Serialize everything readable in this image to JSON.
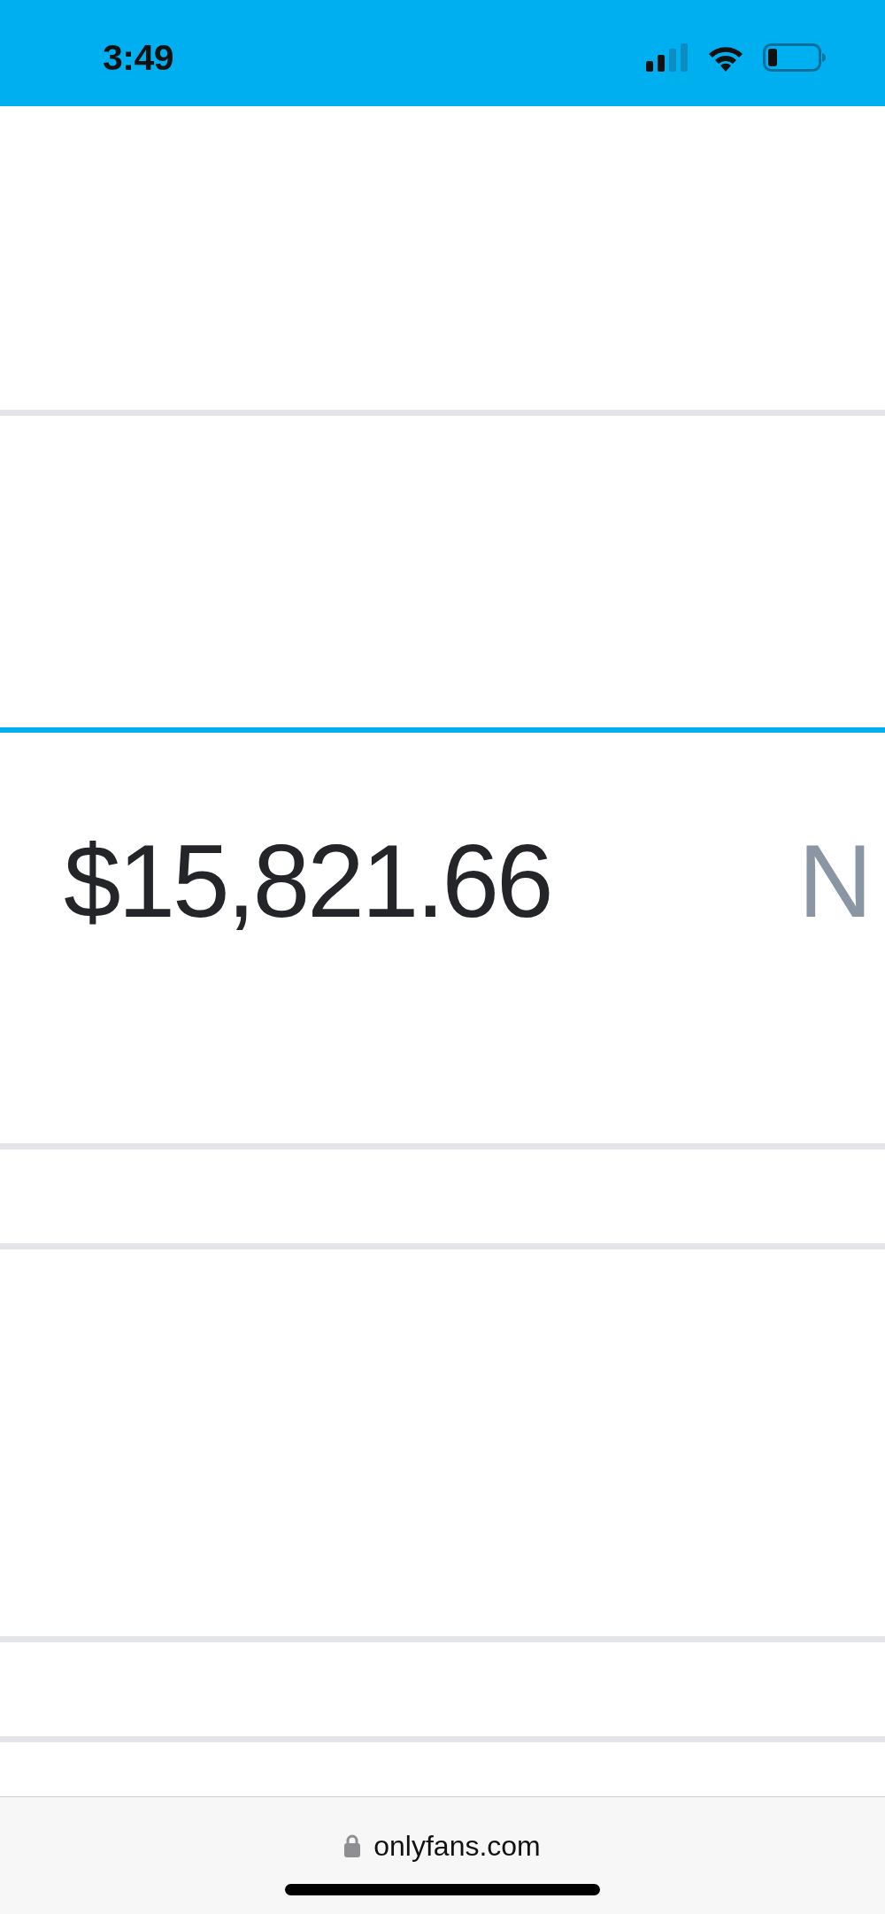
{
  "status_bar": {
    "time": "3:49"
  },
  "balance": {
    "amount": "$15,821.66",
    "column_2": "N"
  },
  "browser_bar": {
    "url": "onlyfans.com"
  }
}
